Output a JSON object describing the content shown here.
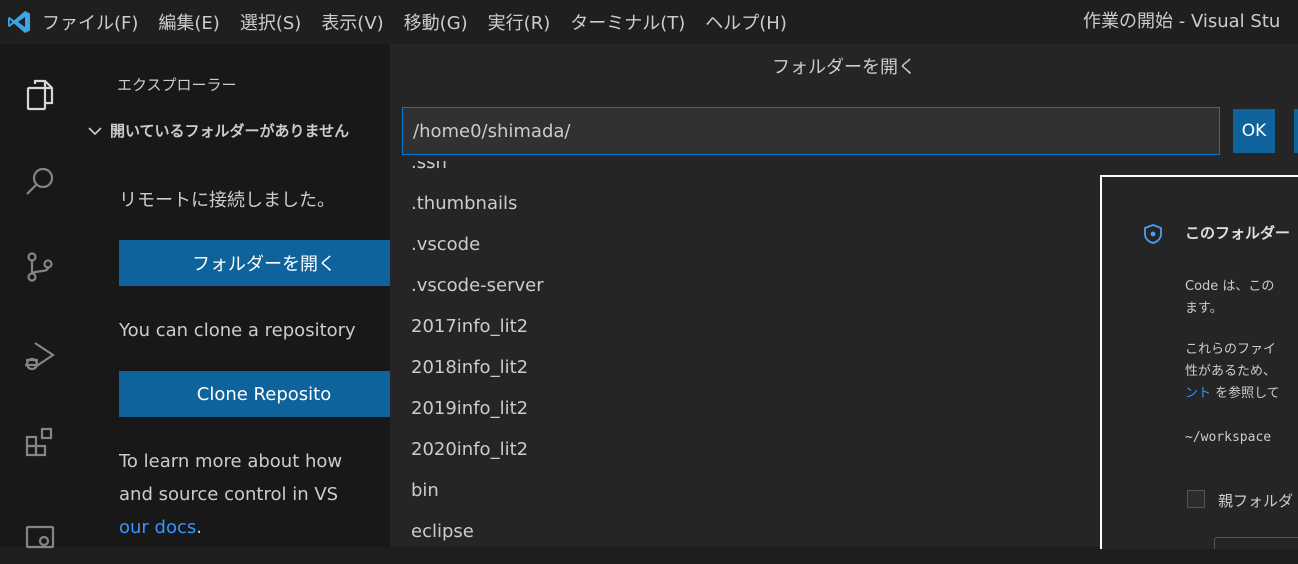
{
  "menu": {
    "items": [
      "ファイル(F)",
      "編集(E)",
      "選択(S)",
      "表示(V)",
      "移動(G)",
      "実行(R)",
      "ターミナル(T)",
      "ヘルプ(H)"
    ],
    "window_title": "作業の開始 - Visual Stu"
  },
  "activity": {
    "icons": [
      "explorer-icon",
      "search-icon",
      "source-control-icon",
      "run-debug-icon",
      "extensions-icon",
      "remote-explorer-icon"
    ]
  },
  "sidebar": {
    "title": "エクスプローラー",
    "section": "開いているフォルダーがありません",
    "remote_text": "リモートに接続しました。",
    "open_folder_label": "フォルダーを開く",
    "clone_text": "You can clone a repository",
    "clone_button_label": "Clone Reposito",
    "learn_line1": "To learn more about how",
    "learn_line2": "and source control in VS",
    "docs_link": "our docs",
    "docs_period": "."
  },
  "dialog": {
    "title": "フォルダーを開く",
    "path_value": "/home0/shimada/",
    "ok_label": "OK",
    "items": [
      ".ssh",
      ".thumbnails",
      ".vscode",
      ".vscode-server",
      "2017info_lit2",
      "2018info_lit2",
      "2019info_lit2",
      "2020info_lit2",
      "bin",
      "eclipse"
    ]
  },
  "trust": {
    "title": "このフォルダー",
    "line1": "Code は、この",
    "line2": "ます。",
    "line3": "これらのファイ",
    "line4": "性があるため、",
    "line5_link": "ント",
    "line5_rest": "を参照して",
    "path": "~/workspace",
    "checkbox_label": "親フォルダ"
  },
  "colors": {
    "accent_button": "#0e639c",
    "focus_border": "#0078d4",
    "link": "#3794ff",
    "background": "#1e1e1e"
  }
}
